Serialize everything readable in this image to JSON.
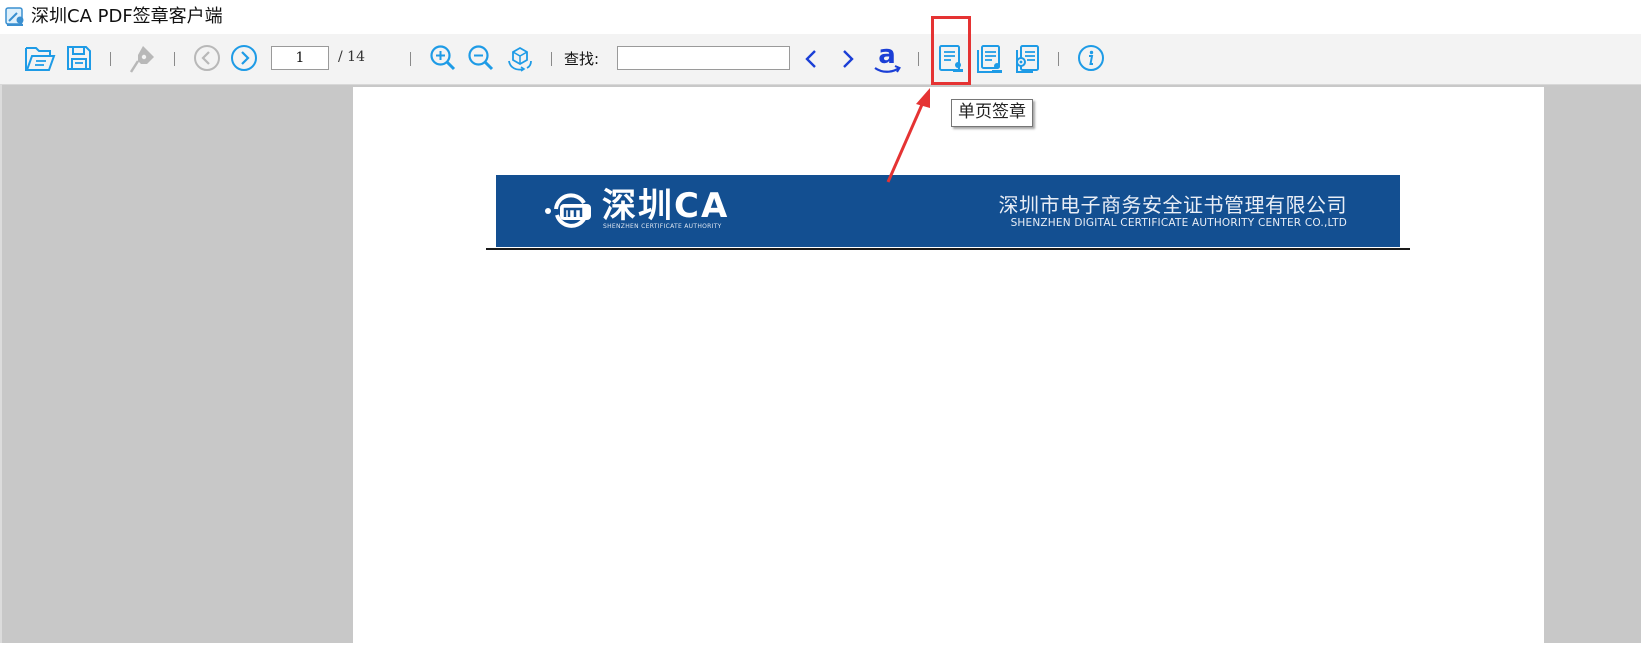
{
  "window": {
    "title": "深圳CA PDF签章客户端",
    "icon": "app-seal-icon"
  },
  "toolbar": {
    "open_icon": "folder-open-icon",
    "save_icon": "save-icon",
    "sign_icon": "pen-nib-icon",
    "prev_page_icon": "circle-chevron-left-icon",
    "next_page_icon": "circle-chevron-right-icon",
    "current_page": "1",
    "total_pages": "/ 14",
    "zoom_in_icon": "zoom-in-icon",
    "zoom_out_icon": "zoom-out-icon",
    "rotate_icon": "rotate-cube-icon",
    "find_label": "查找:",
    "find_value": "",
    "find_prev_icon": "chevron-left-icon",
    "find_next_icon": "chevron-right-icon",
    "amazon_icon": "amazon-icon",
    "single_page_sign_icon": "single-page-sign-icon",
    "multi_page_sign_icon": "multi-page-sign-icon",
    "seam_sign_icon": "seam-sign-icon",
    "info_icon": "info-icon"
  },
  "tooltip": {
    "text": "单页签章"
  },
  "document": {
    "logo_text": "深圳CA",
    "logo_subtext": "SHENZHEN CERTIFICATE AUTHORITY",
    "company_name_cn": "深圳市电子商务安全证书管理有限公司",
    "company_name_en": "SHENZHEN DIGITAL CERTIFICATE AUTHORITY CENTER CO.,LTD"
  },
  "colors": {
    "accent_blue": "#1e9be6",
    "banner_blue": "#134f91",
    "highlight_red": "#e53333",
    "viewer_gray": "#c8c8c8"
  }
}
